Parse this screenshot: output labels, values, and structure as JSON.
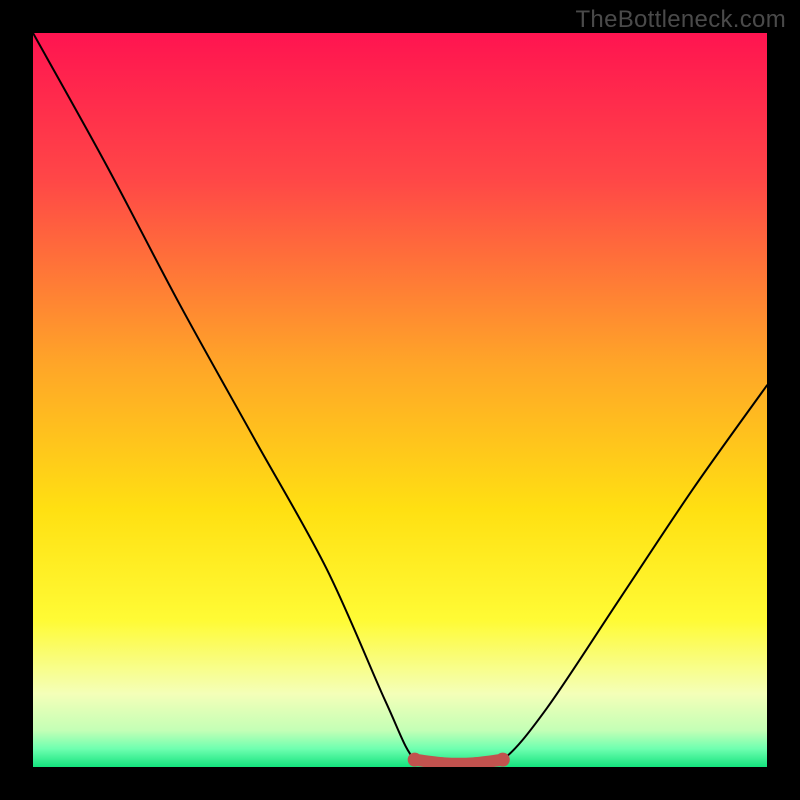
{
  "watermark": "TheBottleneck.com",
  "chart_data": {
    "type": "line",
    "title": "",
    "xlabel": "",
    "ylabel": "",
    "xlim": [
      0,
      100
    ],
    "ylim": [
      0,
      100
    ],
    "grid": false,
    "legend": false,
    "series": [
      {
        "name": "bottleneck-curve",
        "x": [
          0,
          10,
          20,
          30,
          40,
          48,
          52,
          56,
          60,
          64,
          70,
          80,
          90,
          100
        ],
        "y": [
          100,
          82,
          63,
          45,
          27,
          9,
          1,
          0.5,
          0.5,
          1,
          8,
          23,
          38,
          52
        ],
        "color": "#000000"
      },
      {
        "name": "optimal-zone",
        "x": [
          52,
          56,
          60,
          64
        ],
        "y": [
          1,
          0.5,
          0.5,
          1
        ],
        "color": "#c1524e"
      }
    ],
    "gradient_stops": [
      {
        "offset": 0.0,
        "color": "#ff1450"
      },
      {
        "offset": 0.2,
        "color": "#ff4747"
      },
      {
        "offset": 0.45,
        "color": "#ffa528"
      },
      {
        "offset": 0.65,
        "color": "#ffe012"
      },
      {
        "offset": 0.8,
        "color": "#fffb35"
      },
      {
        "offset": 0.9,
        "color": "#f4ffb8"
      },
      {
        "offset": 0.95,
        "color": "#c4ffb6"
      },
      {
        "offset": 0.975,
        "color": "#6fffb0"
      },
      {
        "offset": 1.0,
        "color": "#14e37d"
      }
    ]
  }
}
